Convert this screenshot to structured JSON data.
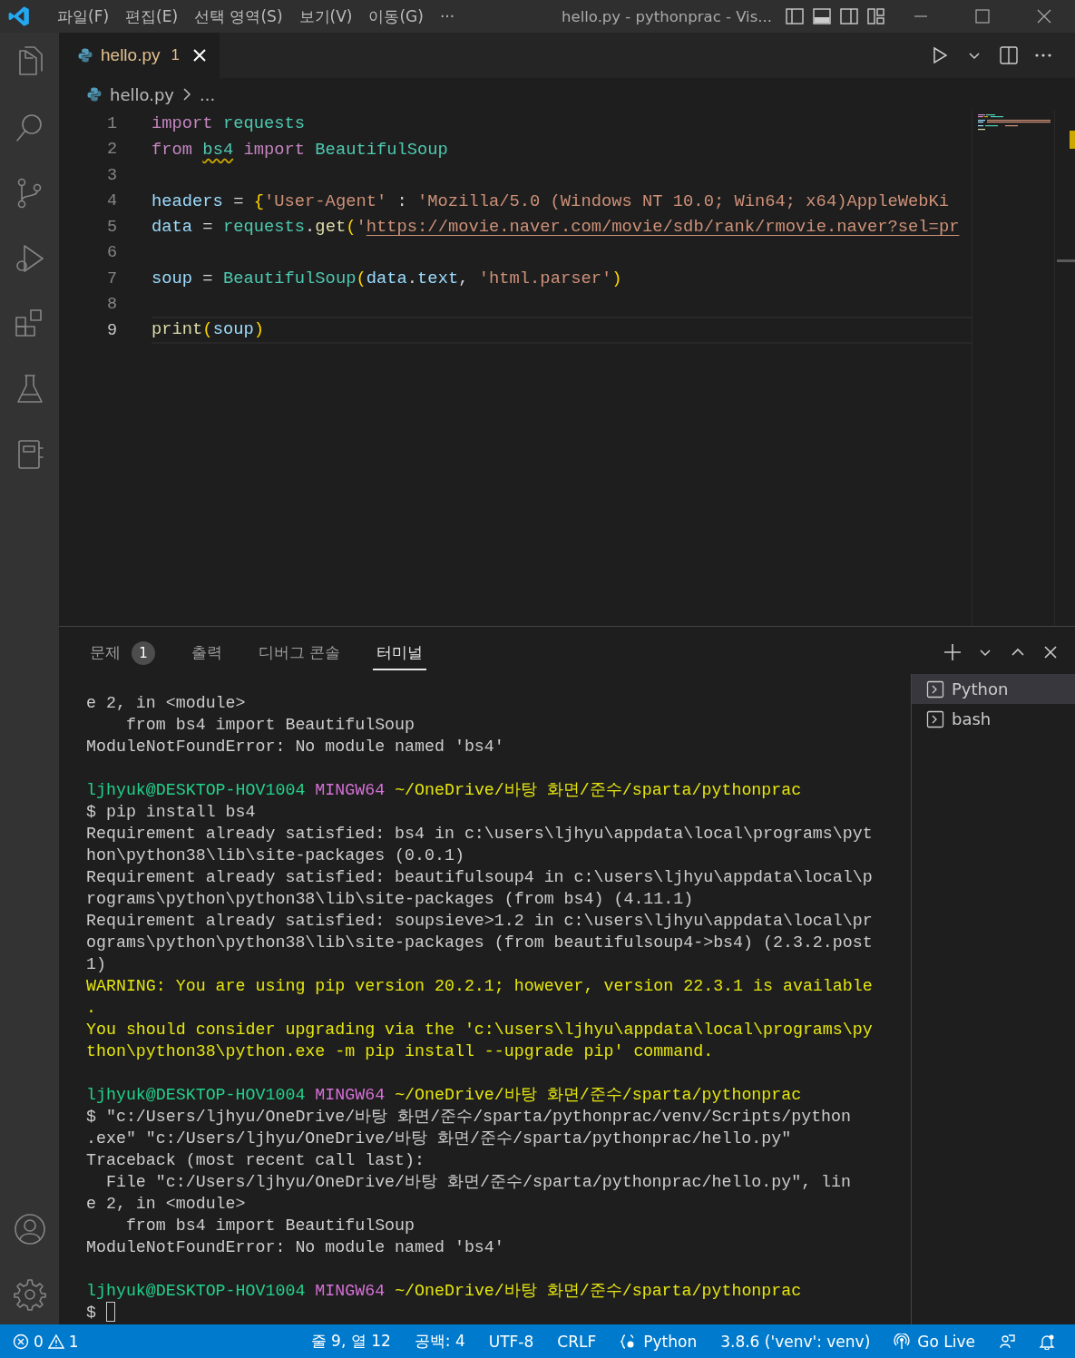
{
  "title_bar": {
    "menu": [
      "파일(F)",
      "편집(E)",
      "선택 영역(S)",
      "보기(V)",
      "이동(G)"
    ],
    "overflow": "···",
    "title": "hello.py - pythonprac - Vis..."
  },
  "editor": {
    "tab": {
      "label": "hello.py",
      "problems": "1"
    },
    "breadcrumb": {
      "file": "hello.py",
      "rest": "..."
    },
    "lines": [
      {
        "number": "1",
        "current": false,
        "tokens": [
          {
            "kind": "keyword",
            "text": "import "
          },
          {
            "kind": "module",
            "text": "requests"
          }
        ]
      },
      {
        "number": "2",
        "current": false,
        "tokens": [
          {
            "kind": "keyword",
            "text": "from "
          },
          {
            "kind": "warned",
            "text": "bs4"
          },
          {
            "kind": "keyword",
            "text": " import "
          },
          {
            "kind": "module",
            "text": "BeautifulSoup"
          }
        ]
      },
      {
        "number": "3",
        "current": false
      },
      {
        "number": "4",
        "current": false,
        "tokens": [
          {
            "kind": "variable",
            "text": "headers"
          },
          {
            "kind": "plain",
            "text": " = "
          },
          {
            "kind": "bracket",
            "text": "{"
          },
          {
            "kind": "string",
            "text": "'User-Agent'"
          },
          {
            "kind": "plain",
            "text": " : "
          },
          {
            "kind": "string",
            "text": "'Mozilla/5.0 (Windows NT 10.0; Win64; x64)AppleWebKi"
          }
        ]
      },
      {
        "number": "5",
        "current": false,
        "tokens": [
          {
            "kind": "variable",
            "text": "data"
          },
          {
            "kind": "plain",
            "text": " = "
          },
          {
            "kind": "module",
            "text": "requests"
          },
          {
            "kind": "plain",
            "text": "."
          },
          {
            "kind": "function",
            "text": "get"
          },
          {
            "kind": "bracket",
            "text": "("
          },
          {
            "kind": "string",
            "text": "'"
          },
          {
            "kind": "link",
            "text": "https://movie.naver.com/movie/sdb/rank/rmovie.naver?sel=pr"
          }
        ]
      },
      {
        "number": "6",
        "current": false
      },
      {
        "number": "7",
        "current": false,
        "tokens": [
          {
            "kind": "variable",
            "text": "soup"
          },
          {
            "kind": "plain",
            "text": " = "
          },
          {
            "kind": "module",
            "text": "BeautifulSoup"
          },
          {
            "kind": "bracket",
            "text": "("
          },
          {
            "kind": "variable",
            "text": "data"
          },
          {
            "kind": "plain",
            "text": "."
          },
          {
            "kind": "variable",
            "text": "text"
          },
          {
            "kind": "plain",
            "text": ", "
          },
          {
            "kind": "string",
            "text": "'html.parser'"
          },
          {
            "kind": "bracket",
            "text": ")"
          }
        ]
      },
      {
        "number": "8",
        "current": false
      },
      {
        "number": "9",
        "current": true,
        "tokens": [
          {
            "kind": "function",
            "text": "print"
          },
          {
            "kind": "bracket",
            "text": "("
          },
          {
            "kind": "variable",
            "text": "soup"
          },
          {
            "kind": "bracket",
            "text": ")"
          }
        ]
      }
    ]
  },
  "panel": {
    "tabs": [
      {
        "label": "문제",
        "badge": "1",
        "selected": false
      },
      {
        "label": "출력",
        "selected": false
      },
      {
        "label": "디버그 콘솔",
        "selected": false
      },
      {
        "label": "터미널",
        "selected": true
      }
    ],
    "terminal_lines": [
      {
        "kind": "plain",
        "text": "e 2, in <module>"
      },
      {
        "kind": "plain",
        "text": "    from bs4 import BeautifulSoup"
      },
      {
        "kind": "plain",
        "text": "ModuleNotFoundError: No module named 'bs4'"
      },
      {
        "kind": "blank"
      },
      {
        "kind": "prompt",
        "user": "ljhyuk@DESKTOP-HOV1004",
        "shell": "MINGW64",
        "path": "~/OneDrive/바탕 화면/준수/sparta/pythonprac"
      },
      {
        "kind": "plain",
        "text": "$ pip install bs4"
      },
      {
        "kind": "plain",
        "text": "Requirement already satisfied: bs4 in c:\\users\\ljhyu\\appdata\\local\\programs\\pyt"
      },
      {
        "kind": "plain",
        "text": "hon\\python38\\lib\\site-packages (0.0.1)"
      },
      {
        "kind": "plain",
        "text": "Requirement already satisfied: beautifulsoup4 in c:\\users\\ljhyu\\appdata\\local\\p"
      },
      {
        "kind": "plain",
        "text": "rograms\\python\\python38\\lib\\site-packages (from bs4) (4.11.1)"
      },
      {
        "kind": "plain",
        "text": "Requirement already satisfied: soupsieve>1.2 in c:\\users\\ljhyu\\appdata\\local\\pr"
      },
      {
        "kind": "plain",
        "text": "ograms\\python\\python38\\lib\\site-packages (from beautifulsoup4->bs4) (2.3.2.post"
      },
      {
        "kind": "plain",
        "text": "1)"
      },
      {
        "kind": "warning",
        "text": "WARNING: You are using pip version 20.2.1; however, version 22.3.1 is available"
      },
      {
        "kind": "warning",
        "text": "."
      },
      {
        "kind": "warning",
        "text": "You should consider upgrading via the 'c:\\users\\ljhyu\\appdata\\local\\programs\\py"
      },
      {
        "kind": "warning",
        "text": "thon\\python38\\python.exe -m pip install --upgrade pip' command."
      },
      {
        "kind": "blank"
      },
      {
        "kind": "prompt",
        "user": "ljhyuk@DESKTOP-HOV1004",
        "shell": "MINGW64",
        "path": "~/OneDrive/바탕 화면/준수/sparta/pythonprac"
      },
      {
        "kind": "plain",
        "text": "$ \"c:/Users/ljhyu/OneDrive/바탕 화면/준수/sparta/pythonprac/venv/Scripts/python"
      },
      {
        "kind": "plain",
        "text": ".exe\" \"c:/Users/ljhyu/OneDrive/바탕 화면/준수/sparta/pythonprac/hello.py\""
      },
      {
        "kind": "plain",
        "text": "Traceback (most recent call last):"
      },
      {
        "kind": "plain",
        "text": "  File \"c:/Users/ljhyu/OneDrive/바탕 화면/준수/sparta/pythonprac/hello.py\", lin"
      },
      {
        "kind": "plain",
        "text": "e 2, in <module>"
      },
      {
        "kind": "plain",
        "text": "    from bs4 import BeautifulSoup"
      },
      {
        "kind": "plain",
        "text": "ModuleNotFoundError: No module named 'bs4'"
      },
      {
        "kind": "blank"
      },
      {
        "kind": "prompt",
        "user": "ljhyuk@DESKTOP-HOV1004",
        "shell": "MINGW64",
        "path": "~/OneDrive/바탕 화면/준수/sparta/pythonprac"
      },
      {
        "kind": "input",
        "text": "$",
        "cursor": true
      }
    ],
    "terminals": [
      {
        "label": "Python",
        "selected": true
      },
      {
        "label": "bash",
        "selected": false
      }
    ]
  },
  "status_bar": {
    "errors": "0",
    "warnings": "1",
    "items": [
      {
        "kind": "text",
        "text": "줄 9, 열 12"
      },
      {
        "kind": "text",
        "text": "공백: 4"
      },
      {
        "kind": "text",
        "text": "UTF-8"
      },
      {
        "kind": "text",
        "text": "CRLF"
      },
      {
        "kind": "language",
        "text": "Python"
      },
      {
        "kind": "text",
        "text": "3.8.6 ('venv': venv)"
      },
      {
        "kind": "live",
        "text": "Go Live"
      }
    ]
  }
}
